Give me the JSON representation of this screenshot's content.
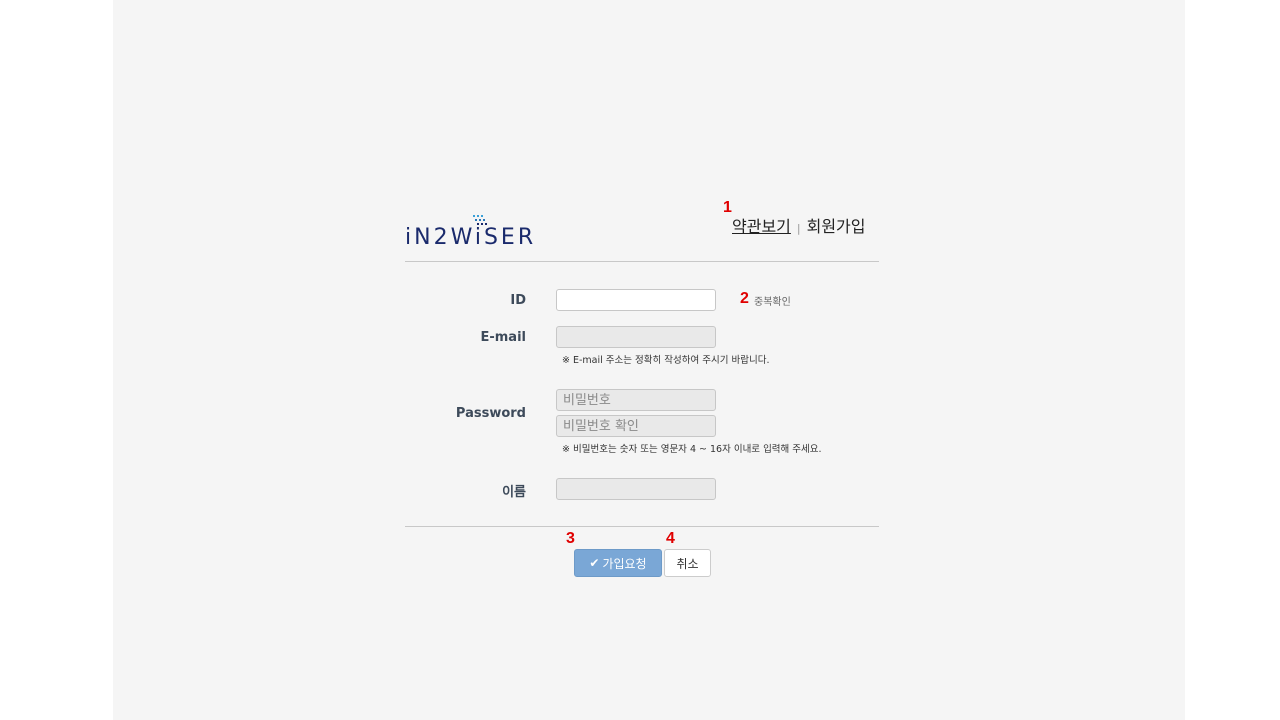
{
  "brand": {
    "logo_text": "iN2WiSER"
  },
  "top_links": {
    "terms": "약관보기",
    "separator": "|",
    "signup": "회원가입"
  },
  "markers": {
    "m1": "1",
    "m2": "2",
    "m3": "3",
    "m4": "4"
  },
  "form": {
    "id_label": "ID",
    "id_value": "",
    "dup_check": "중복확인",
    "email_label": "E-mail",
    "email_value": "",
    "email_note": "※ E-mail 주소는 정확히 작성하여 주시기 바랍니다.",
    "password_label": "Password",
    "password_placeholder": "비밀번호",
    "password_confirm_placeholder": "비밀번호 확인",
    "password_note": "※ 비밀번호는 숫자 또는 영문자 4 ~ 16자 이내로 입력해 주세요.",
    "name_label": "이름",
    "name_value": ""
  },
  "actions": {
    "submit_label": "가입요청",
    "cancel_label": "취소"
  },
  "colors": {
    "background": "#f5f5f5",
    "submit_button": "#7aa7d6",
    "marker": "#e00000",
    "logo": "#1a2a6c"
  }
}
